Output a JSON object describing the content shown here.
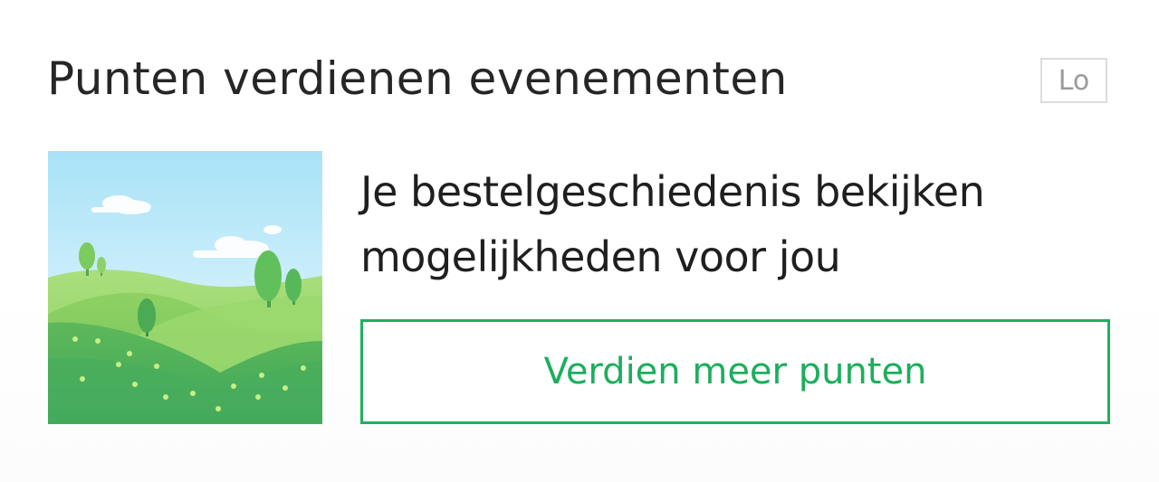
{
  "header": {
    "title": "Punten verdienen evenementen",
    "badge_label": "Lo"
  },
  "card": {
    "image_icon": "landscape-illustration",
    "description_line1": "Je bestelgeschiedenis bekijken",
    "description_line2": "mogelijkheden voor jou",
    "cta_label": "Verdien meer punten"
  },
  "colors": {
    "accent": "#1cae5d",
    "title": "#262626",
    "badge_border": "#dcdcdc",
    "badge_text": "#9a9a9a"
  }
}
